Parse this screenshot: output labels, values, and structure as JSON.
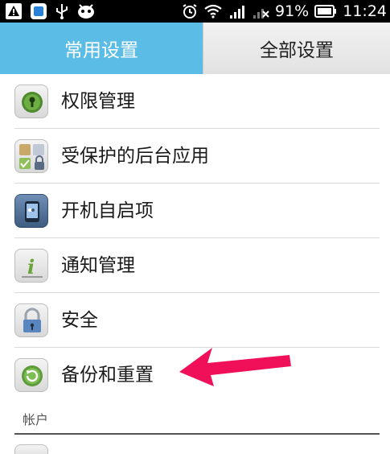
{
  "status_bar": {
    "battery": "91%",
    "time": "11:24",
    "icons": [
      "warning-notification-icon",
      "app-notification-icon",
      "usb-icon",
      "android-icon",
      "alarm-icon",
      "wifi-icon",
      "signal-icon",
      "no-signal-icon",
      "battery-icon"
    ]
  },
  "tabs": {
    "common": "常用设置",
    "all": "全部设置"
  },
  "settings": {
    "items": [
      {
        "label": "权限管理",
        "icon": "permission-icon"
      },
      {
        "label": "受保护的后台应用",
        "icon": "protected-apps-icon"
      },
      {
        "label": "开机自启项",
        "icon": "startup-icon"
      },
      {
        "label": "通知管理",
        "icon": "notification-icon"
      },
      {
        "label": "安全",
        "icon": "lock-icon"
      },
      {
        "label": "备份和重置",
        "icon": "backup-icon"
      }
    ],
    "section_accounts": "帐户"
  },
  "colors": {
    "tab_active": "#5bbde6",
    "arrow": "#f0105a"
  }
}
